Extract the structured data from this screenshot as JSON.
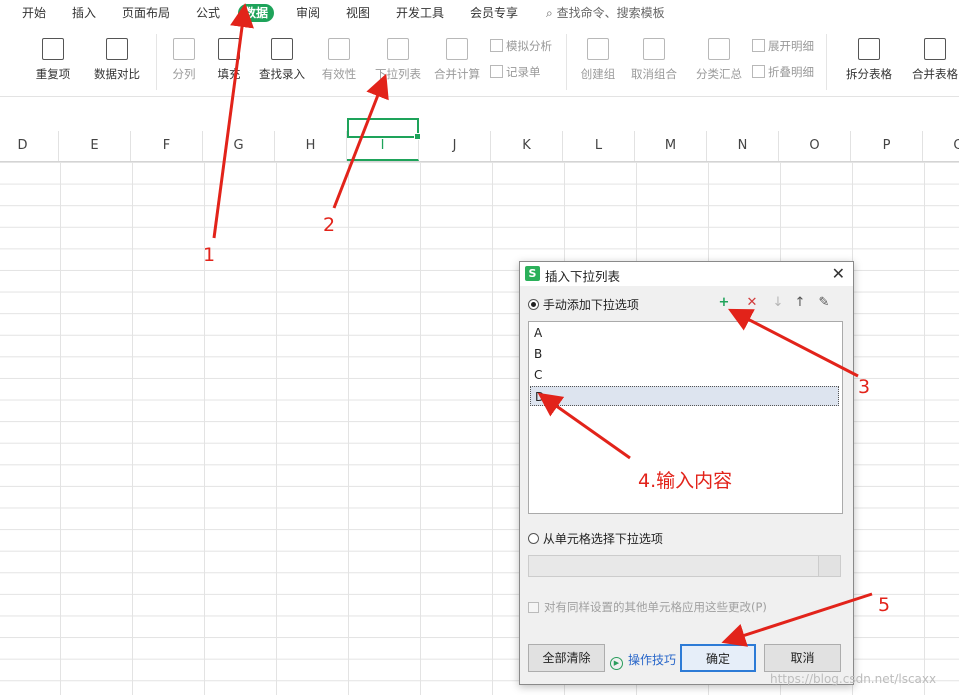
{
  "menu": {
    "items": [
      "开始",
      "插入",
      "页面布局",
      "公式",
      "数据",
      "审阅",
      "视图",
      "开发工具",
      "会员专享"
    ],
    "active_index": 4,
    "search_placeholder": "查找命令、搜索模板"
  },
  "ribbon": {
    "buttons": [
      "重复项",
      "数据对比",
      "分列",
      "填充",
      "查找录入",
      "有效性",
      "下拉列表",
      "合并计算",
      "创建组",
      "取消组合",
      "分类汇总",
      "拆分表格",
      "合并表格"
    ],
    "small_buttons": [
      "模拟分析",
      "记录单",
      "展开明细",
      "折叠明细"
    ]
  },
  "sheet": {
    "columns": [
      "D",
      "E",
      "F",
      "G",
      "H",
      "I",
      "J",
      "K",
      "L",
      "M",
      "N",
      "O",
      "P",
      "Q"
    ],
    "selected_column": "I"
  },
  "dialog": {
    "title": "插入下拉列表",
    "logo": "S",
    "close": "✕",
    "option_manual": "手动添加下拉选项",
    "option_from_cells": "从单元格选择下拉选项",
    "items": [
      "A",
      "B",
      "C",
      "D"
    ],
    "selected_item_index": 3,
    "apply_label": "对有同样设置的其他单元格应用这些更改(P)",
    "clear_all": "全部清除",
    "tips": "操作技巧",
    "ok": "确定",
    "cancel": "取消"
  },
  "annotations": {
    "step1": "1",
    "step2": "2",
    "step3": "3",
    "step4": "4.输入内容",
    "step5": "5",
    "arrow_color": "#e2231a"
  },
  "watermark": "https://blog.csdn.net/lscaxx",
  "colors": {
    "accent": "#1ea35a",
    "primary_border": "#2d7bd6"
  }
}
